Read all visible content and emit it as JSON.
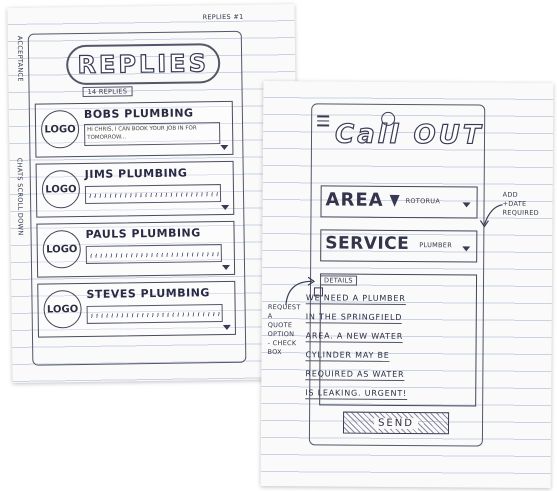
{
  "left_sheet": {
    "title": "REPLIES",
    "reply_count": "14 REPLIES",
    "corner_note": "REPLIES #1",
    "side_note_left": "ACCEPTANCE",
    "side_note_left2": "CHATS SCROLL DOWN",
    "cards": [
      {
        "logo": "LOGO",
        "name": "BOBS PLUMBING",
        "desc": "Hi CHRIS, I CAN BOOK YOUR JOB IN FOR TOMORROW..."
      },
      {
        "logo": "LOGO",
        "name": "JIMS PLUMBING",
        "desc": ""
      },
      {
        "logo": "LOGO",
        "name": "PAULS PLUMBING",
        "desc": ""
      },
      {
        "logo": "LOGO",
        "name": "STEVES PLUMBING",
        "desc": ""
      }
    ]
  },
  "right_sheet": {
    "brand": "Call OUT",
    "area": {
      "label": "AREA",
      "value": "ROTORUA"
    },
    "service": {
      "label": "SERVICE",
      "value": "PLUMBER"
    },
    "details_label": "DETAILS",
    "details_lines": [
      "WE NEED A PLUMBER",
      "IN THE SPRINGFIELD",
      "AREA. A NEW WATER",
      "CYLINDER MAY BE",
      "REQUIRED AS WATER",
      "IS LEAKING. URGENT!"
    ],
    "send_label": "SEND",
    "note_right": [
      "ADD",
      "+DATE",
      "REQUIRED"
    ],
    "note_left": [
      "REQUEST",
      "A",
      "QUOTE",
      "OPTION",
      "- CHECK",
      "BOX"
    ]
  },
  "colors": {
    "ink": "#34344a",
    "paper": "#fafafa",
    "ruled": "#c9d3e3"
  }
}
